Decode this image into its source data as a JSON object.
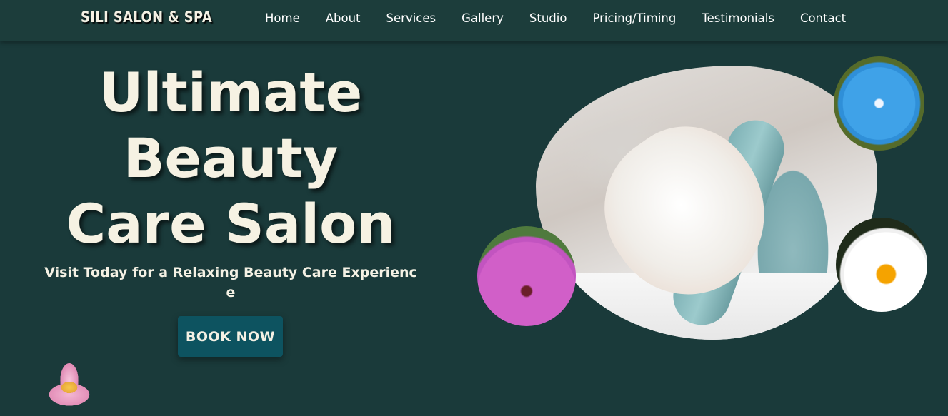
{
  "brand": {
    "logo_text": "SILI SALON & SPA"
  },
  "nav": {
    "items": [
      {
        "label": "Home"
      },
      {
        "label": "About"
      },
      {
        "label": "Services"
      },
      {
        "label": "Gallery"
      },
      {
        "label": "Studio"
      },
      {
        "label": "Pricing/Timing"
      },
      {
        "label": "Testimonials"
      },
      {
        "label": "Contact"
      }
    ]
  },
  "hero": {
    "title_lines": [
      "Ultimate",
      "Beauty",
      "Care Salon"
    ],
    "subtitle": "Visit Today for a Relaxing Beauty Care Experience",
    "cta_label": "BOOK NOW"
  },
  "colors": {
    "background": "#1a3a3a",
    "navbar": "#1c3d3b",
    "title_text": "#f6f2e3",
    "button_bg": "#0d5360"
  },
  "images": {
    "main": "woman-facial-mask-photo",
    "top_right": "blue-forget-me-not-flower",
    "left": "pink-cosmos-flower",
    "bottom_right": "white-daisy-flower",
    "corner": "pink-lotus-flower"
  }
}
